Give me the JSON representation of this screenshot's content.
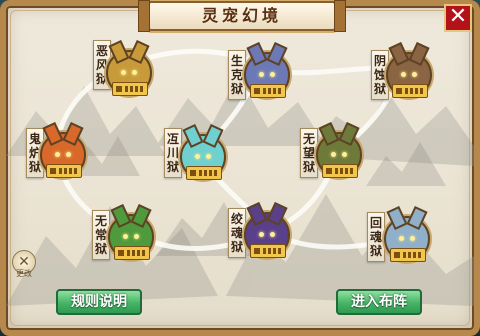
{
  "window": {
    "title": "灵宠幻境",
    "close_glyph": "✕"
  },
  "side": {
    "left_icon_glyph": "✕",
    "left_icon_label": "更改"
  },
  "nodes": [
    {
      "label": "恶风狱",
      "icon": "golden-dragon-beast-icon",
      "color": "#c99a3a"
    },
    {
      "label": "生克狱",
      "icon": "blue-horned-beast-icon",
      "color": "#6d79b6"
    },
    {
      "label": "阴蚀狱",
      "icon": "horned-demon-beast-icon",
      "color": "#8a6443"
    },
    {
      "label": "鬼炉狱",
      "icon": "fire-beast-icon",
      "color": "#d9682b"
    },
    {
      "label": "冱川狱",
      "icon": "ice-beast-icon",
      "color": "#6fd0cf"
    },
    {
      "label": "无望狱",
      "icon": "green-armored-beast-icon",
      "color": "#6e7a3a"
    },
    {
      "label": "无常狱",
      "icon": "green-demon-beast-icon",
      "color": "#4f9a3c"
    },
    {
      "label": "绞魂狱",
      "icon": "purple-horned-beast-icon",
      "color": "#5a3f8a"
    },
    {
      "label": "回魂狱",
      "icon": "pale-maiden-beast-icon",
      "color": "#8fb0c8"
    }
  ],
  "buttons": {
    "rules": "规则说明",
    "enter": "进入布阵"
  },
  "colors": {
    "frame": "#b6884b",
    "parchment": "#ebe4d4",
    "close_red": "#b4121a",
    "button_green": "#47b466"
  }
}
